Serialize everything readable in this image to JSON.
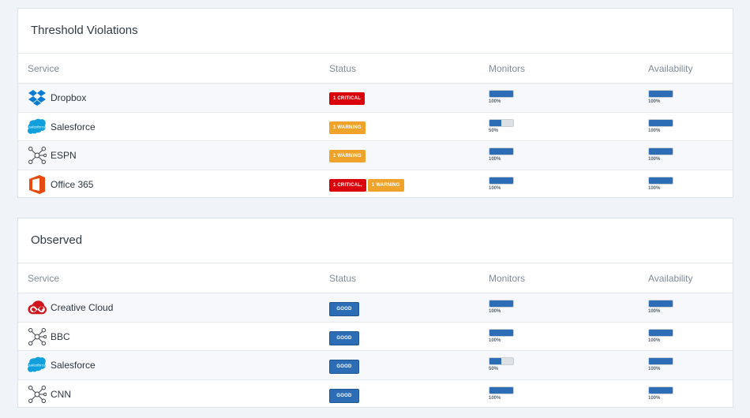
{
  "panels": [
    {
      "title": "Threshold Violations",
      "headers": {
        "service": "Service",
        "status": "Status",
        "monitors": "Monitors",
        "availability": "Availability"
      },
      "rows": [
        {
          "service": "Dropbox",
          "logo": "dropbox-logo-icon",
          "badges": [
            {
              "label": "1 CRITICAL",
              "kind": "critical"
            }
          ],
          "monitors": {
            "value": 1.0,
            "label": "100%"
          },
          "availability": {
            "value": 1.0,
            "label": "100%"
          }
        },
        {
          "service": "Salesforce",
          "logo": "salesforce-logo-icon",
          "badges": [
            {
              "label": "1 WARNING",
              "kind": "warning"
            }
          ],
          "monitors": {
            "value": 0.5,
            "label": "50%"
          },
          "availability": {
            "value": 1.0,
            "label": "100%"
          }
        },
        {
          "service": "ESPN",
          "logo": "network-node-icon",
          "badges": [
            {
              "label": "1 WARNING",
              "kind": "warning"
            }
          ],
          "monitors": {
            "value": 1.0,
            "label": "100%"
          },
          "availability": {
            "value": 1.0,
            "label": "100%"
          }
        },
        {
          "service": "Office 365",
          "logo": "office365-logo-icon",
          "badges": [
            {
              "label": "1 CRITICAL,",
              "kind": "critical"
            },
            {
              "label": "1 WARNING",
              "kind": "warning"
            }
          ],
          "monitors": {
            "value": 1.0,
            "label": "100%"
          },
          "availability": {
            "value": 1.0,
            "label": "100%"
          }
        }
      ]
    },
    {
      "title": "Observed",
      "headers": {
        "service": "Service",
        "status": "Status",
        "monitors": "Monitors",
        "availability": "Availability"
      },
      "rows": [
        {
          "service": "Creative Cloud",
          "logo": "creative-cloud-logo-icon",
          "badges": [
            {
              "label": "GOOD",
              "kind": "good"
            }
          ],
          "monitors": {
            "value": 1.0,
            "label": "100%"
          },
          "availability": {
            "value": 1.0,
            "label": "100%"
          }
        },
        {
          "service": "BBC",
          "logo": "network-node-icon",
          "badges": [
            {
              "label": "GOOD",
              "kind": "good"
            }
          ],
          "monitors": {
            "value": 1.0,
            "label": "100%"
          },
          "availability": {
            "value": 1.0,
            "label": "100%"
          }
        },
        {
          "service": "Salesforce",
          "logo": "salesforce-logo-icon",
          "badges": [
            {
              "label": "GOOD",
              "kind": "good"
            }
          ],
          "monitors": {
            "value": 0.5,
            "label": "50%"
          },
          "availability": {
            "value": 1.0,
            "label": "100%"
          }
        },
        {
          "service": "CNN",
          "logo": "network-node-icon",
          "badges": [
            {
              "label": "GOOD",
              "kind": "good"
            }
          ],
          "monitors": {
            "value": 1.0,
            "label": "100%"
          },
          "availability": {
            "value": 1.0,
            "label": "100%"
          }
        }
      ]
    }
  ],
  "colors": {
    "critical": "#d9000b",
    "warning": "#f0a32a",
    "good": "#2d6db6",
    "bar_fill": "#2d6db6",
    "bar_track": "#dde1e6"
  }
}
